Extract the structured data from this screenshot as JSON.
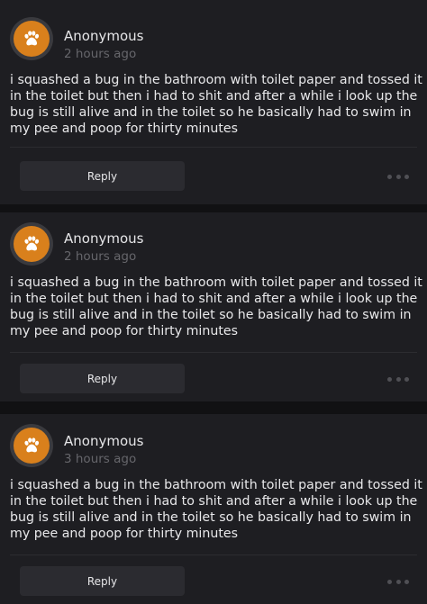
{
  "posts": [
    {
      "username": "Anonymous",
      "timestamp": "2 hours ago",
      "text": "i squashed a bug in the bathroom with toilet paper and tossed it in the toilet but then i had to shit and after a while i look up the bug is still alive and in the toilet so he basically had to swim in my pee and poop for thirty minutes",
      "reply_label": "Reply",
      "avatar_icon": "paw-icon"
    },
    {
      "username": "Anonymous",
      "timestamp": "2 hours ago",
      "text": "i squashed a bug in the bathroom with toilet paper and tossed it in the toilet but then i had to shit and after a while i look up the bug is still alive and in the toilet so he basically had to swim in my pee and poop for thirty minutes",
      "reply_label": "Reply",
      "avatar_icon": "paw-icon"
    },
    {
      "username": "Anonymous",
      "timestamp": "3 hours ago",
      "text": "i squashed a bug in the bathroom with toilet paper and tossed it in the toilet but then i had to shit and after a while i look up the bug is still alive and in the toilet so he basically had to swim in my pee and poop for thirty minutes",
      "reply_label": "Reply",
      "avatar_icon": "paw-icon"
    }
  ],
  "colors": {
    "background": "#111113",
    "card": "#1e1e22",
    "avatar": "#d9801c",
    "reply_button": "#2b2b30",
    "secondary_text": "#66666b"
  }
}
